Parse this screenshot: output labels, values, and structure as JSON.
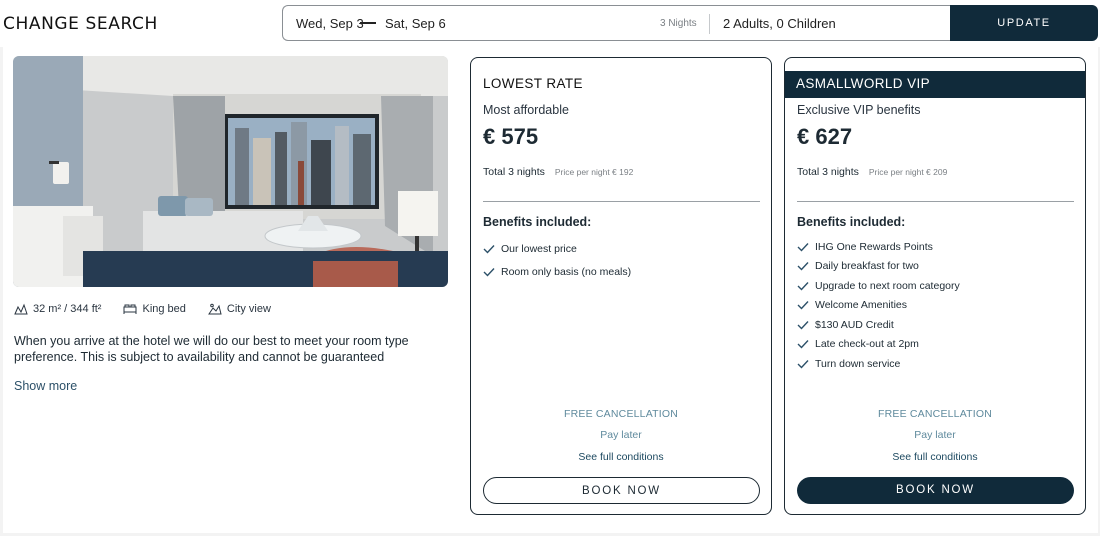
{
  "header": {
    "change_search": "CHANGE SEARCH",
    "date_start": "Wed, Sep 3",
    "date_end": "Sat, Sep 6",
    "nights": "3 Nights",
    "guests": "2 Adults, 0 Children",
    "update_label": "UPDATE"
  },
  "room": {
    "features": [
      {
        "icon": "area-icon",
        "label": "32 m² / 344 ft²"
      },
      {
        "icon": "bed-icon",
        "label": "King bed"
      },
      {
        "icon": "city-view-icon",
        "label": "City view"
      }
    ],
    "description": "When you arrive at the hotel we will do our best to meet your room type preference. This is subject to availability and cannot be guaranteed",
    "show_more": "Show more"
  },
  "rates": [
    {
      "title": "LOWEST RATE",
      "subtitle": "Most affordable",
      "price": "€ 575",
      "total": "Total 3 nights",
      "per_night": "Price per night € 192",
      "benefits_heading": "Benefits included:",
      "benefits": [
        "Our lowest price",
        "Room only basis (no meals)"
      ],
      "free_cancellation": "FREE CANCELLATION",
      "pay_later": "Pay later",
      "conditions": "See full conditions",
      "book": "BOOK NOW"
    },
    {
      "title": "ASMALLWORLD VIP",
      "subtitle": "Exclusive VIP benefits",
      "price": "€ 627",
      "total": "Total 3 nights",
      "per_night": "Price per night € 209",
      "benefits_heading": "Benefits included:",
      "benefits": [
        "IHG One Rewards Points",
        "Daily breakfast for two",
        "Upgrade to next room category",
        "Welcome Amenities",
        "$130 AUD Credit",
        "Late check-out at 2pm",
        "Turn down service"
      ],
      "free_cancellation": "FREE CANCELLATION",
      "pay_later": "Pay later",
      "conditions": "See full conditions",
      "book": "BOOK NOW"
    }
  ],
  "colors": {
    "navy": "#102a3a",
    "accent_teal": "#5f8a9d"
  }
}
